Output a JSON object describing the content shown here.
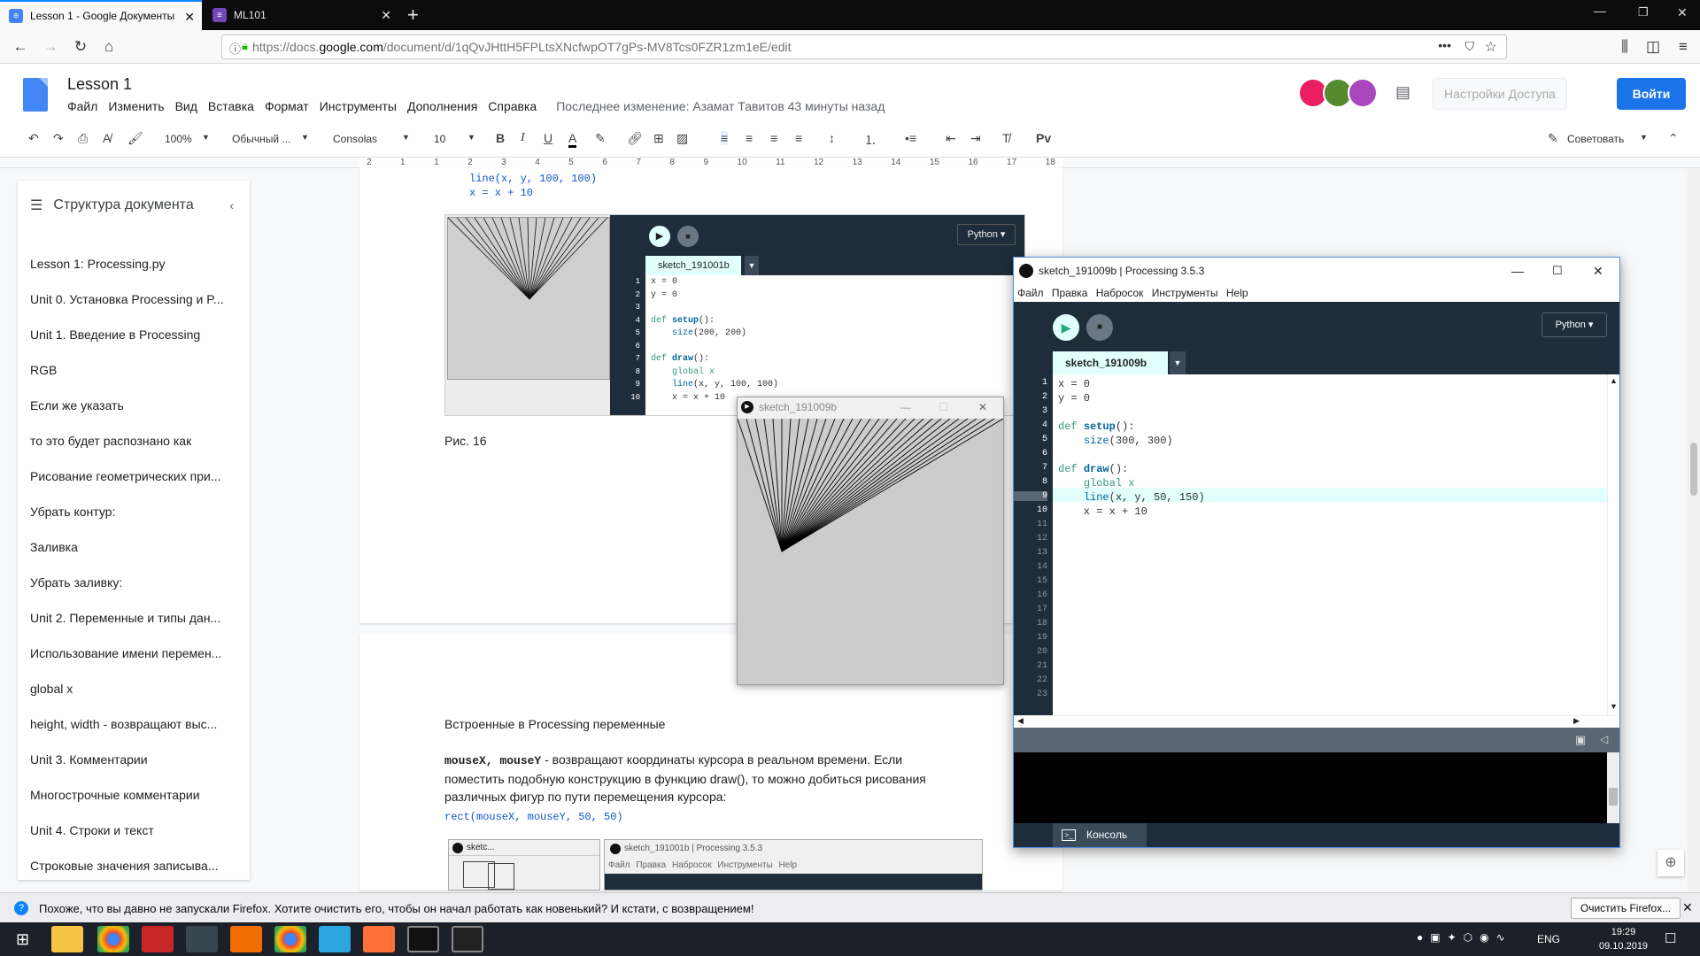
{
  "browser": {
    "tabs": [
      {
        "label": "Lesson 1 - Google Документы",
        "active": true
      },
      {
        "label": "ML101",
        "active": false
      }
    ],
    "url": {
      "prefix": "https://docs.",
      "domain": "google.com",
      "path": "/document/d/1qQvJHttH5FPLtsXNcfwpOT7gPs-MV8Tcs0FZR1zm1eE/edit"
    }
  },
  "docs": {
    "title": "Lesson 1",
    "menu": [
      "Файл",
      "Изменить",
      "Вид",
      "Вставка",
      "Формат",
      "Инструменты",
      "Дополнения",
      "Справка"
    ],
    "last_edit": "Последнее изменение: Азамат Тавитов 43 минуты назад",
    "share_label": "Настройки Доступа",
    "login_label": "Войти",
    "toolbar": {
      "zoom": "100%",
      "style": "Обычный ...",
      "font": "Consolas",
      "size": "10",
      "suggest": "Советовать"
    },
    "ruler_ticks": [
      "2",
      "1",
      "1",
      "2",
      "3",
      "4",
      "5",
      "6",
      "7",
      "8",
      "9",
      "10",
      "11",
      "12",
      "13",
      "14",
      "15",
      "16",
      "17",
      "18"
    ],
    "outline": {
      "header": "Структура документа",
      "items": [
        "Lesson 1: Processing.py",
        "Unit 0. Установка Processing и P...",
        "Unit 1. Введение в Processing",
        "RGB",
        "Если же указать",
        "то это будет распознано как",
        "Рисование геометрических при...",
        "Убрать контур:",
        "Заливка",
        "Убрать заливку:",
        "Unit 2. Переменные и типы дан...",
        "Использование имени перемен...",
        "global x",
        "height, width - возвращают выс...",
        "Unit 3. Комментарии",
        "Многострочные комментарии",
        "Unit 4. Строки и текст",
        "Строковые значения записыва..."
      ]
    },
    "page1": {
      "code_top": [
        "line(x, y, 100, 100)",
        "x = x + 10"
      ],
      "caption": "Рис. 16"
    },
    "page2": {
      "heading": "Встроенные в Processing переменные",
      "para_code": "mouseX, mouseY",
      "para_text": " - возвращают координаты курсора в  реальном времени. Если",
      "para_line2": "поместить подобную конструкцию в функцию draw(), то можно добиться рисования",
      "para_line3": "различных фигур по пути перемещения курсора:",
      "code": "rect(mouseX, mouseY, 50, 50)"
    }
  },
  "embedded_pde": {
    "mode": "Python ▾",
    "tab": "sketch_191001b",
    "lines": [
      "x = 0",
      "y = 0",
      "",
      "def setup():",
      "    size(200, 200)",
      "",
      "def draw():",
      "    global x",
      "    line(x, y, 100, 100)",
      "    x = x + 10"
    ]
  },
  "embedded_pde2": {
    "title": "sketch_191001b | Processing 3.5.3",
    "mini_title": "sketc...",
    "menu": [
      "Файл",
      "Правка",
      "Набросок",
      "Инструменты",
      "Help"
    ]
  },
  "sketch_window": {
    "title": "sketch_191009b"
  },
  "processing": {
    "title": "sketch_191009b | Processing 3.5.3",
    "menu": [
      "Файл",
      "Правка",
      "Набросок",
      "Инструменты",
      "Help"
    ],
    "mode": "Python ▾",
    "tab": "sketch_191009b",
    "lines": [
      "x = 0",
      "y = 0",
      "",
      "def setup():",
      "    size(300, 300)",
      "",
      "def draw():",
      "    global x",
      "    line(x, y, 50, 150)",
      "    x = x + 10"
    ],
    "line_count": 23,
    "console_label": "Консоль"
  },
  "firefox_notice": {
    "text": "Похоже, что вы давно не запускали Firefox. Хотите очистить его, чтобы он начал работать как новенький? И кстати, с возвращением!",
    "button": "Очистить Firefox..."
  },
  "taskbar": {
    "lang": "ENG",
    "time": "19:29",
    "date": "09.10.2019"
  },
  "colors": {
    "docs_blue": "#1a73e8",
    "pde_dark": "#1f2d3a",
    "pde_accent": "#e0fffd",
    "firefox_blue": "#0a84ff"
  }
}
